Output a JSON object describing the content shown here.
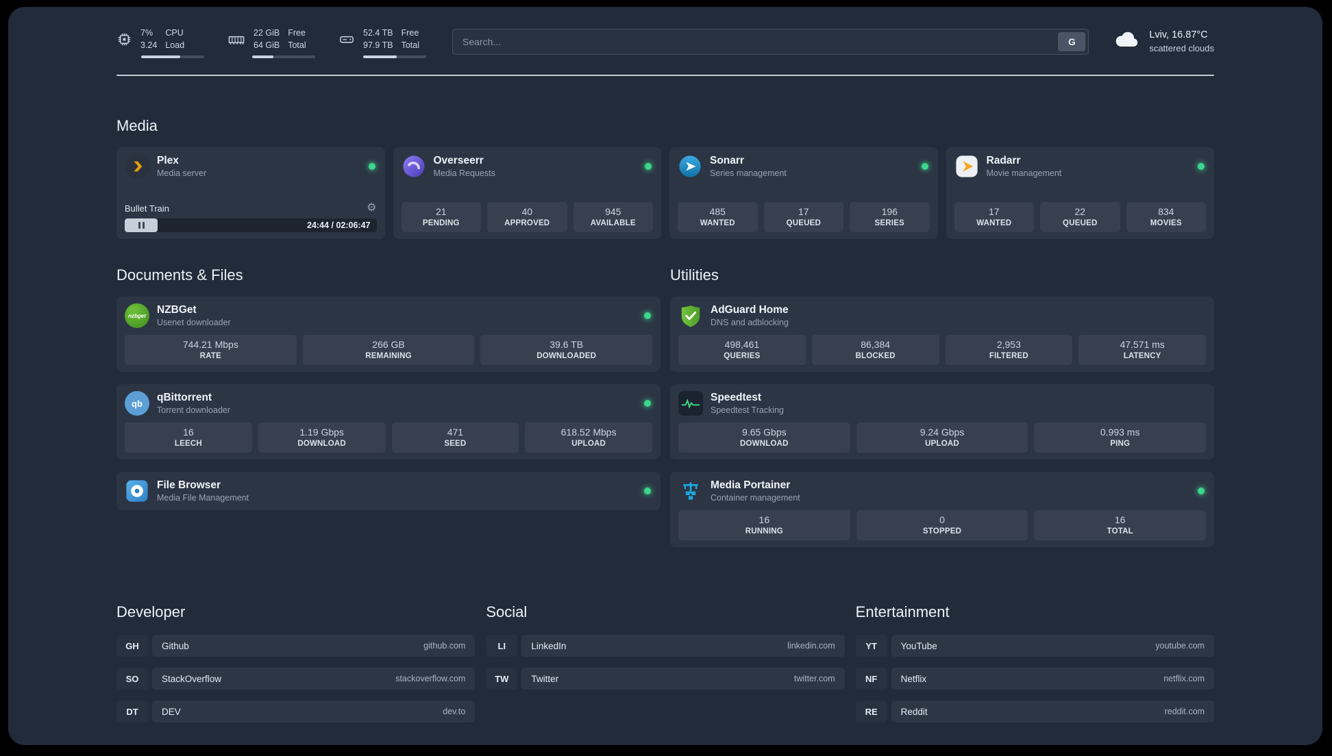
{
  "colors": {
    "background": "#212b3a",
    "status_online": "#3dd68c",
    "plex_accent": "#e5a00d"
  },
  "header": {
    "resources": [
      {
        "icon": "cpu-icon",
        "value_top": "7%",
        "value_bottom": "3.24",
        "label_top": "CPU",
        "label_bottom": "Load",
        "progress_pct": 62
      },
      {
        "icon": "memory-icon",
        "value_top": "22 GiB",
        "value_bottom": "64 GiB",
        "label_top": "Free",
        "label_bottom": "Total",
        "progress_pct": 34
      },
      {
        "icon": "disk-icon",
        "value_top": "52.4 TB",
        "value_bottom": "97.9 TB",
        "label_top": "Free",
        "label_bottom": "Total",
        "progress_pct": 53
      }
    ],
    "search": {
      "placeholder": "Search...",
      "button_label": "G"
    },
    "weather": {
      "location": "Lviv, 16.87°C",
      "condition": "scattered clouds"
    }
  },
  "sections": {
    "media": {
      "title": "Media",
      "plex": {
        "name": "Plex",
        "desc": "Media server",
        "now_playing": "Bullet Train",
        "time": "24:44 / 02:06:47"
      },
      "overseerr": {
        "name": "Overseerr",
        "desc": "Media Requests",
        "stats": [
          {
            "value": "21",
            "label": "PENDING"
          },
          {
            "value": "40",
            "label": "APPROVED"
          },
          {
            "value": "945",
            "label": "AVAILABLE"
          }
        ]
      },
      "sonarr": {
        "name": "Sonarr",
        "desc": "Series management",
        "stats": [
          {
            "value": "485",
            "label": "WANTED"
          },
          {
            "value": "17",
            "label": "QUEUED"
          },
          {
            "value": "196",
            "label": "SERIES"
          }
        ]
      },
      "radarr": {
        "name": "Radarr",
        "desc": "Movie management",
        "stats": [
          {
            "value": "17",
            "label": "WANTED"
          },
          {
            "value": "22",
            "label": "QUEUED"
          },
          {
            "value": "834",
            "label": "MOVIES"
          }
        ]
      }
    },
    "documents": {
      "title": "Documents & Files",
      "nzbget": {
        "name": "NZBGet",
        "desc": "Usenet downloader",
        "icon_text": "nzbget",
        "stats": [
          {
            "value": "744.21 Mbps",
            "label": "RATE"
          },
          {
            "value": "266 GB",
            "label": "REMAINING"
          },
          {
            "value": "39.6 TB",
            "label": "DOWNLOADED"
          }
        ]
      },
      "qbittorrent": {
        "name": "qBittorrent",
        "desc": "Torrent downloader",
        "icon_text": "qb",
        "stats": [
          {
            "value": "16",
            "label": "LEECH"
          },
          {
            "value": "1.19 Gbps",
            "label": "DOWNLOAD"
          },
          {
            "value": "471",
            "label": "SEED"
          },
          {
            "value": "618.52 Mbps",
            "label": "UPLOAD"
          }
        ]
      },
      "filebrowser": {
        "name": "File Browser",
        "desc": "Media File Management"
      }
    },
    "utilities": {
      "title": "Utilities",
      "adguard": {
        "name": "AdGuard Home",
        "desc": "DNS and adblocking",
        "stats": [
          {
            "value": "498,461",
            "label": "QUERIES"
          },
          {
            "value": "86,384",
            "label": "BLOCKED"
          },
          {
            "value": "2,953",
            "label": "FILTERED"
          },
          {
            "value": "47.571 ms",
            "label": "LATENCY"
          }
        ]
      },
      "speedtest": {
        "name": "Speedtest",
        "desc": "Speedtest Tracking",
        "stats": [
          {
            "value": "9.65 Gbps",
            "label": "DOWNLOAD"
          },
          {
            "value": "9.24 Gbps",
            "label": "UPLOAD"
          },
          {
            "value": "0.993 ms",
            "label": "PING"
          }
        ]
      },
      "portainer": {
        "name": "Media Portainer",
        "desc": "Container management",
        "stats": [
          {
            "value": "16",
            "label": "RUNNING"
          },
          {
            "value": "0",
            "label": "STOPPED"
          },
          {
            "value": "16",
            "label": "TOTAL"
          }
        ]
      }
    },
    "bookmarks": [
      {
        "title": "Developer",
        "items": [
          {
            "abbr": "GH",
            "name": "Github",
            "domain": "github.com"
          },
          {
            "abbr": "SO",
            "name": "StackOverflow",
            "domain": "stackoverflow.com"
          },
          {
            "abbr": "DT",
            "name": "DEV",
            "domain": "dev.to"
          }
        ]
      },
      {
        "title": "Social",
        "items": [
          {
            "abbr": "LI",
            "name": "LinkedIn",
            "domain": "linkedin.com"
          },
          {
            "abbr": "TW",
            "name": "Twitter",
            "domain": "twitter.com"
          }
        ]
      },
      {
        "title": "Entertainment",
        "items": [
          {
            "abbr": "YT",
            "name": "YouTube",
            "domain": "youtube.com"
          },
          {
            "abbr": "NF",
            "name": "Netflix",
            "domain": "netflix.com"
          },
          {
            "abbr": "RE",
            "name": "Reddit",
            "domain": "reddit.com"
          }
        ]
      }
    ]
  }
}
